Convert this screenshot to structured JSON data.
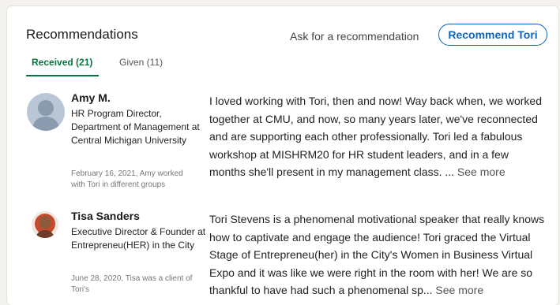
{
  "header": {
    "title": "Recommendations",
    "ask_link": "Ask for a recommendation",
    "recommend_button": "Recommend Tori"
  },
  "tabs": [
    {
      "label": "Received (21)",
      "active": true
    },
    {
      "label": "Given (11)",
      "active": false
    }
  ],
  "recommendations": [
    {
      "name": "Amy M.",
      "role": "HR Program Director, Department of Management at Central Michigan University",
      "meta": "February 16, 2021, Amy worked with Tori in different groups",
      "text": "I loved working with Tori, then and now! Way back when, we worked together at CMU, and now, so many years later, we've reconnected and are supporting each other professionally. Tori led a fabulous workshop at MISHRM20 for HR student leaders, and in a few months she'll present in my management class. ...",
      "see_more": "See more"
    },
    {
      "name": "Tisa Sanders",
      "role": "Executive Director & Founder at Entrepreneu(HER) in the City",
      "meta": "June 28, 2020, Tisa was a client of Tori's",
      "text": "Tori Stevens is a phenomenal motivational speaker that really knows how to captivate and engage the audience! Tori graced the Virtual Stage of Entrepreneu(her) in the City's Women in Business Virtual Expo and it was like we were right in the room with her! We are so thankful to have had such a phenomenal sp...",
      "see_more": "See more"
    }
  ],
  "colors": {
    "accent": "#0a66c2",
    "tab_active": "#057642"
  }
}
